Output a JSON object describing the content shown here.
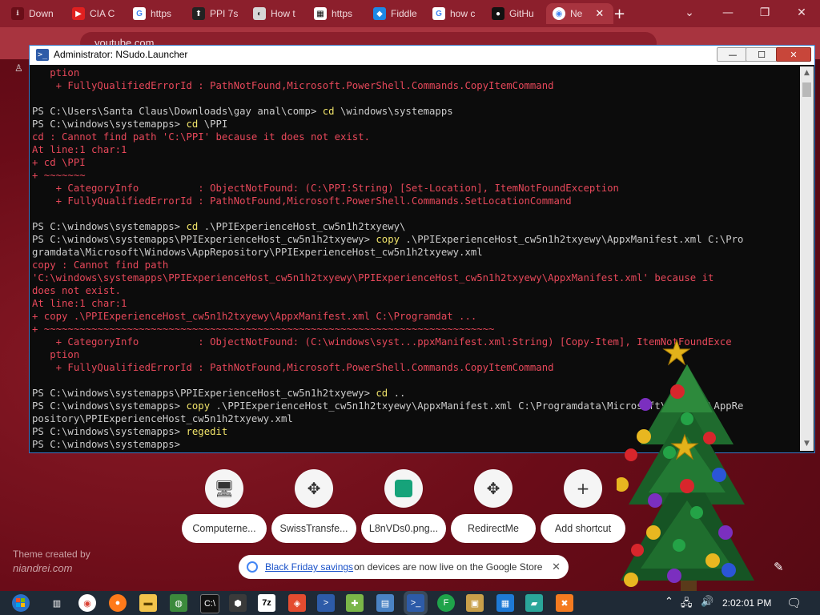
{
  "browser": {
    "tabs": [
      {
        "label": "Down"
      },
      {
        "label": "CIA C"
      },
      {
        "label": "https"
      },
      {
        "label": "PPI 7s"
      },
      {
        "label": "How t"
      },
      {
        "label": "https"
      },
      {
        "label": "Fiddle"
      },
      {
        "label": "how c"
      },
      {
        "label": "GitHu"
      },
      {
        "label": "Ne"
      }
    ],
    "url": "youtube.com"
  },
  "terminal": {
    "title": "Administrator: NSudo.Launcher",
    "lines": [
      {
        "t": "   ption",
        "c": "e"
      },
      {
        "t": "    + FullyQualifiedErrorId : PathNotFound,Microsoft.PowerShell.Commands.CopyItemCommand",
        "c": "e"
      },
      {
        "t": "",
        "c": "w"
      },
      {
        "t": "PS C:\\Users\\Santa Claus\\Downloads\\gay anal\\comp> ",
        "y": "cd",
        "r": " \\windows\\systemapps"
      },
      {
        "t": "PS C:\\windows\\systemapps> ",
        "y": "cd",
        "r": " \\PPI"
      },
      {
        "t": "cd : Cannot find path 'C:\\PPI' because it does not exist.",
        "c": "e"
      },
      {
        "t": "At line:1 char:1",
        "c": "e"
      },
      {
        "t": "+ cd \\PPI",
        "c": "e"
      },
      {
        "t": "+ ~~~~~~~",
        "c": "e"
      },
      {
        "t": "    + CategoryInfo          : ObjectNotFound: (C:\\PPI:String) [Set-Location], ItemNotFoundException",
        "c": "e"
      },
      {
        "t": "    + FullyQualifiedErrorId : PathNotFound,Microsoft.PowerShell.Commands.SetLocationCommand",
        "c": "e"
      },
      {
        "t": "",
        "c": "w"
      },
      {
        "t": "PS C:\\windows\\systemapps> ",
        "y": "cd",
        "r": " .\\PPIExperienceHost_cw5n1h2txyewy\\"
      },
      {
        "t": "PS C:\\windows\\systemapps\\PPIExperienceHost_cw5n1h2txyewy> ",
        "y": "copy",
        "r": " .\\PPIExperienceHost_cw5n1h2txyewy\\AppxManifest.xml C:\\Pro"
      },
      {
        "t": "gramdata\\Microsoft\\Windows\\AppRepository\\PPIExperienceHost_cw5n1h2txyewy.xml",
        "c": "w"
      },
      {
        "t": "copy : Cannot find path",
        "c": "e"
      },
      {
        "t": "'C:\\windows\\systemapps\\PPIExperienceHost_cw5n1h2txyewy\\PPIExperienceHost_cw5n1h2txyewy\\AppxManifest.xml' because it",
        "c": "e"
      },
      {
        "t": "does not exist.",
        "c": "e"
      },
      {
        "t": "At line:1 char:1",
        "c": "e"
      },
      {
        "t": "+ copy .\\PPIExperienceHost_cw5n1h2txyewy\\AppxManifest.xml C:\\Programdat ...",
        "c": "e"
      },
      {
        "t": "+ ~~~~~~~~~~~~~~~~~~~~~~~~~~~~~~~~~~~~~~~~~~~~~~~~~~~~~~~~~~~~~~~~~~~~~~~~~~~~",
        "c": "e"
      },
      {
        "t": "    + CategoryInfo          : ObjectNotFound: (C:\\windows\\syst...ppxManifest.xml:String) [Copy-Item], ItemNotFoundExce",
        "c": "e"
      },
      {
        "t": "   ption",
        "c": "e"
      },
      {
        "t": "    + FullyQualifiedErrorId : PathNotFound,Microsoft.PowerShell.Commands.CopyItemCommand",
        "c": "e"
      },
      {
        "t": "",
        "c": "w"
      },
      {
        "t": "PS C:\\windows\\systemapps\\PPIExperienceHost_cw5n1h2txyewy> ",
        "y": "cd",
        "r": " .."
      },
      {
        "t": "PS C:\\windows\\systemapps> ",
        "y": "copy",
        "r": " .\\PPIExperienceHost_cw5n1h2txyewy\\AppxManifest.xml C:\\Programdata\\Microsoft\\Windows\\AppRe"
      },
      {
        "t": "pository\\PPIExperienceHost_cw5n1h2txyewy.xml",
        "c": "w"
      },
      {
        "t": "PS C:\\windows\\systemapps> ",
        "y": "regedit",
        "r": ""
      },
      {
        "t": "PS C:\\windows\\systemapps>",
        "c": "w"
      }
    ]
  },
  "shortcuts": [
    {
      "label": "Computerne...",
      "icon": "computer-icon"
    },
    {
      "label": "SwissTransfe...",
      "icon": "move-arrows-icon"
    },
    {
      "label": "L8nVDs0.png...",
      "icon": "image-icon"
    },
    {
      "label": "RedirectMe",
      "icon": "move-arrows-icon"
    },
    {
      "label": "Add shortcut",
      "icon": "plus-icon"
    }
  ],
  "theme": {
    "line1": "Theme created by",
    "line2": "niandrei.com"
  },
  "notice": {
    "link": "Black Friday savings",
    "rest": "on devices are now live on the Google Store"
  },
  "clock": {
    "time": "2:02:01 PM"
  },
  "colors": {
    "error": "#e7485a",
    "command": "#f0e36a",
    "text": "#cccccc",
    "chrome": "#a8343f"
  }
}
